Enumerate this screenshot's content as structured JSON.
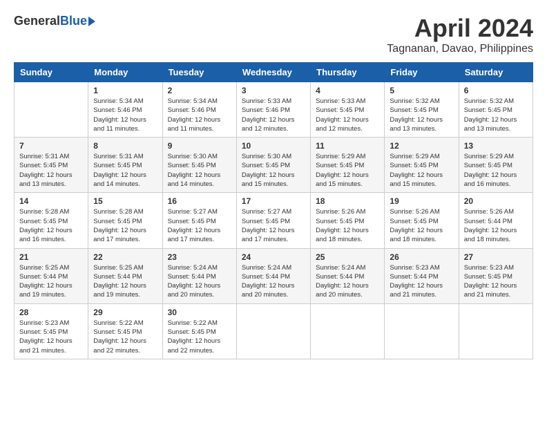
{
  "header": {
    "logo_general": "General",
    "logo_blue": "Blue",
    "title": "April 2024",
    "subtitle": "Tagnanan, Davao, Philippines"
  },
  "calendar": {
    "weekdays": [
      "Sunday",
      "Monday",
      "Tuesday",
      "Wednesday",
      "Thursday",
      "Friday",
      "Saturday"
    ],
    "weeks": [
      [
        {
          "day": null,
          "info": null
        },
        {
          "day": "1",
          "info": "Sunrise: 5:34 AM\nSunset: 5:46 PM\nDaylight: 12 hours\nand 11 minutes."
        },
        {
          "day": "2",
          "info": "Sunrise: 5:34 AM\nSunset: 5:46 PM\nDaylight: 12 hours\nand 11 minutes."
        },
        {
          "day": "3",
          "info": "Sunrise: 5:33 AM\nSunset: 5:46 PM\nDaylight: 12 hours\nand 12 minutes."
        },
        {
          "day": "4",
          "info": "Sunrise: 5:33 AM\nSunset: 5:45 PM\nDaylight: 12 hours\nand 12 minutes."
        },
        {
          "day": "5",
          "info": "Sunrise: 5:32 AM\nSunset: 5:45 PM\nDaylight: 12 hours\nand 13 minutes."
        },
        {
          "day": "6",
          "info": "Sunrise: 5:32 AM\nSunset: 5:45 PM\nDaylight: 12 hours\nand 13 minutes."
        }
      ],
      [
        {
          "day": "7",
          "info": "Sunrise: 5:31 AM\nSunset: 5:45 PM\nDaylight: 12 hours\nand 13 minutes."
        },
        {
          "day": "8",
          "info": "Sunrise: 5:31 AM\nSunset: 5:45 PM\nDaylight: 12 hours\nand 14 minutes."
        },
        {
          "day": "9",
          "info": "Sunrise: 5:30 AM\nSunset: 5:45 PM\nDaylight: 12 hours\nand 14 minutes."
        },
        {
          "day": "10",
          "info": "Sunrise: 5:30 AM\nSunset: 5:45 PM\nDaylight: 12 hours\nand 15 minutes."
        },
        {
          "day": "11",
          "info": "Sunrise: 5:29 AM\nSunset: 5:45 PM\nDaylight: 12 hours\nand 15 minutes."
        },
        {
          "day": "12",
          "info": "Sunrise: 5:29 AM\nSunset: 5:45 PM\nDaylight: 12 hours\nand 15 minutes."
        },
        {
          "day": "13",
          "info": "Sunrise: 5:29 AM\nSunset: 5:45 PM\nDaylight: 12 hours\nand 16 minutes."
        }
      ],
      [
        {
          "day": "14",
          "info": "Sunrise: 5:28 AM\nSunset: 5:45 PM\nDaylight: 12 hours\nand 16 minutes."
        },
        {
          "day": "15",
          "info": "Sunrise: 5:28 AM\nSunset: 5:45 PM\nDaylight: 12 hours\nand 17 minutes."
        },
        {
          "day": "16",
          "info": "Sunrise: 5:27 AM\nSunset: 5:45 PM\nDaylight: 12 hours\nand 17 minutes."
        },
        {
          "day": "17",
          "info": "Sunrise: 5:27 AM\nSunset: 5:45 PM\nDaylight: 12 hours\nand 17 minutes."
        },
        {
          "day": "18",
          "info": "Sunrise: 5:26 AM\nSunset: 5:45 PM\nDaylight: 12 hours\nand 18 minutes."
        },
        {
          "day": "19",
          "info": "Sunrise: 5:26 AM\nSunset: 5:45 PM\nDaylight: 12 hours\nand 18 minutes."
        },
        {
          "day": "20",
          "info": "Sunrise: 5:26 AM\nSunset: 5:44 PM\nDaylight: 12 hours\nand 18 minutes."
        }
      ],
      [
        {
          "day": "21",
          "info": "Sunrise: 5:25 AM\nSunset: 5:44 PM\nDaylight: 12 hours\nand 19 minutes."
        },
        {
          "day": "22",
          "info": "Sunrise: 5:25 AM\nSunset: 5:44 PM\nDaylight: 12 hours\nand 19 minutes."
        },
        {
          "day": "23",
          "info": "Sunrise: 5:24 AM\nSunset: 5:44 PM\nDaylight: 12 hours\nand 20 minutes."
        },
        {
          "day": "24",
          "info": "Sunrise: 5:24 AM\nSunset: 5:44 PM\nDaylight: 12 hours\nand 20 minutes."
        },
        {
          "day": "25",
          "info": "Sunrise: 5:24 AM\nSunset: 5:44 PM\nDaylight: 12 hours\nand 20 minutes."
        },
        {
          "day": "26",
          "info": "Sunrise: 5:23 AM\nSunset: 5:44 PM\nDaylight: 12 hours\nand 21 minutes."
        },
        {
          "day": "27",
          "info": "Sunrise: 5:23 AM\nSunset: 5:45 PM\nDaylight: 12 hours\nand 21 minutes."
        }
      ],
      [
        {
          "day": "28",
          "info": "Sunrise: 5:23 AM\nSunset: 5:45 PM\nDaylight: 12 hours\nand 21 minutes."
        },
        {
          "day": "29",
          "info": "Sunrise: 5:22 AM\nSunset: 5:45 PM\nDaylight: 12 hours\nand 22 minutes."
        },
        {
          "day": "30",
          "info": "Sunrise: 5:22 AM\nSunset: 5:45 PM\nDaylight: 12 hours\nand 22 minutes."
        },
        {
          "day": null,
          "info": null
        },
        {
          "day": null,
          "info": null
        },
        {
          "day": null,
          "info": null
        },
        {
          "day": null,
          "info": null
        }
      ]
    ]
  }
}
